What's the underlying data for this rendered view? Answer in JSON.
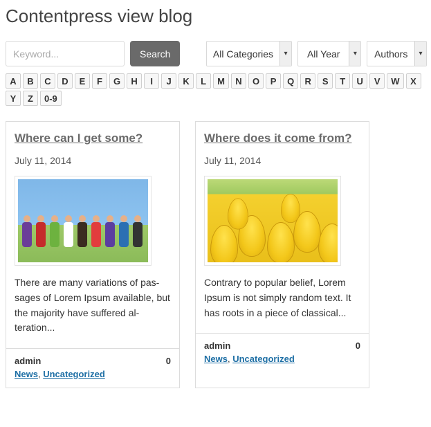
{
  "page_title": "Contentpress view blog",
  "search": {
    "placeholder": "Keyword...",
    "button_label": "Search"
  },
  "filters": {
    "categories": {
      "label": "All Categories"
    },
    "year": {
      "label": "All Year"
    },
    "authors": {
      "label": "Authors"
    }
  },
  "alpha": [
    "A",
    "B",
    "C",
    "D",
    "E",
    "F",
    "G",
    "H",
    "I",
    "J",
    "K",
    "L",
    "M",
    "N",
    "O",
    "P",
    "Q",
    "R",
    "S",
    "T",
    "U",
    "V",
    "W",
    "X",
    "Y",
    "Z",
    "0-9"
  ],
  "posts": [
    {
      "title": "Where can I get some?",
      "date": "July 11, 2014",
      "image": "people",
      "excerpt": "There are many variations of pas­sages of Lorem Ipsum available, but the majority have suffered al­teration...",
      "author": "admin",
      "comments": "0",
      "cats": [
        "News",
        "Uncategorized"
      ]
    },
    {
      "title": "Where does it come from?",
      "date": "July 11, 2014",
      "image": "tulips",
      "excerpt": "Contrary to popular belief, Lorem Ipsum is not simply random text. It has roots in a piece of classical...",
      "author": "admin",
      "comments": "0",
      "cats": [
        "News",
        "Uncategorized"
      ]
    }
  ],
  "cat_sep": ", "
}
